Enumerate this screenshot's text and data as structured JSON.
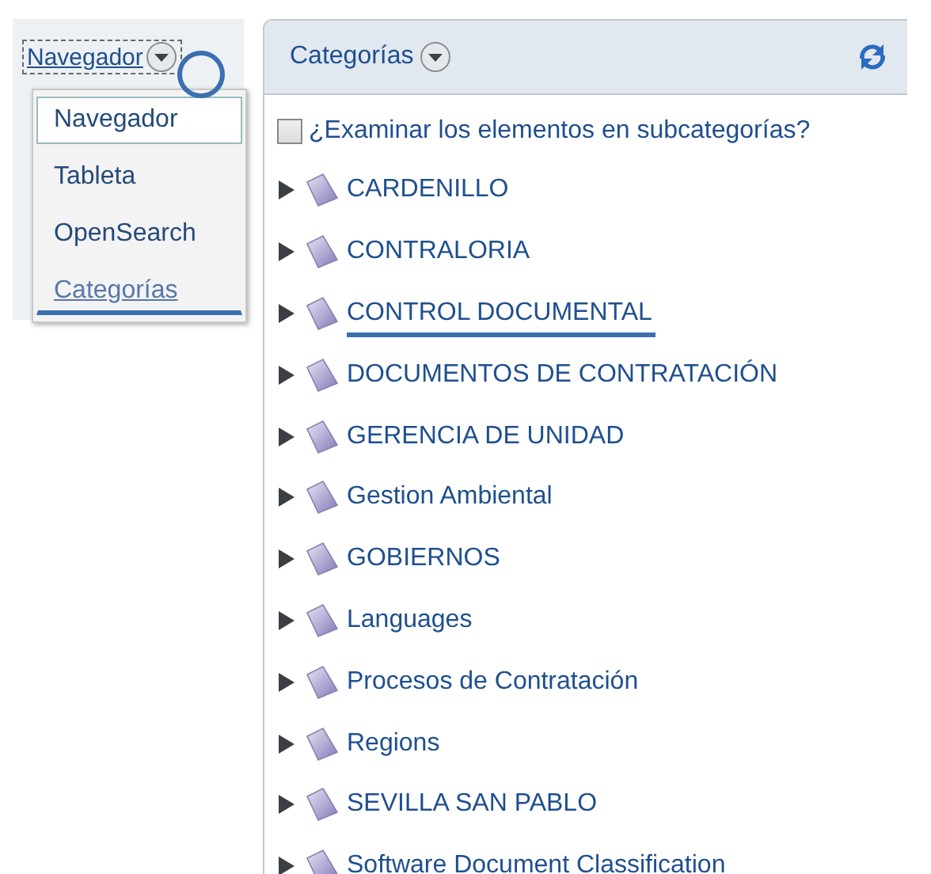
{
  "view_switcher": {
    "label": "Navegador",
    "circled": true
  },
  "view_menu": [
    {
      "label": "Navegador",
      "selected": true,
      "kind": "item",
      "underlined": false
    },
    {
      "label": "Tableta",
      "selected": false,
      "kind": "item",
      "underlined": false
    },
    {
      "label": "OpenSearch",
      "selected": false,
      "kind": "item",
      "underlined": false
    },
    {
      "label": "Categorías",
      "selected": false,
      "kind": "link",
      "underlined": true
    }
  ],
  "panel": {
    "title": "Categorías"
  },
  "subcategories": {
    "label": "¿Examinar los elementos en subcategorías?",
    "checked": false
  },
  "categories": [
    {
      "name": "CARDENILLO",
      "underlined": false
    },
    {
      "name": "CONTRALORIA",
      "underlined": false
    },
    {
      "name": "CONTROL DOCUMENTAL",
      "underlined": true
    },
    {
      "name": "DOCUMENTOS DE CONTRATACIÓN",
      "underlined": false
    },
    {
      "name": "GERENCIA DE UNIDAD",
      "underlined": false
    },
    {
      "name": "Gestion Ambiental",
      "underlined": false
    },
    {
      "name": "GOBIERNOS",
      "underlined": false
    },
    {
      "name": "Languages",
      "underlined": false
    },
    {
      "name": "Procesos de Contratación",
      "underlined": false
    },
    {
      "name": "Regions",
      "underlined": false
    },
    {
      "name": "SEVILLA SAN PABLO",
      "underlined": false
    },
    {
      "name": "Software Document Classification",
      "underlined": false
    }
  ]
}
